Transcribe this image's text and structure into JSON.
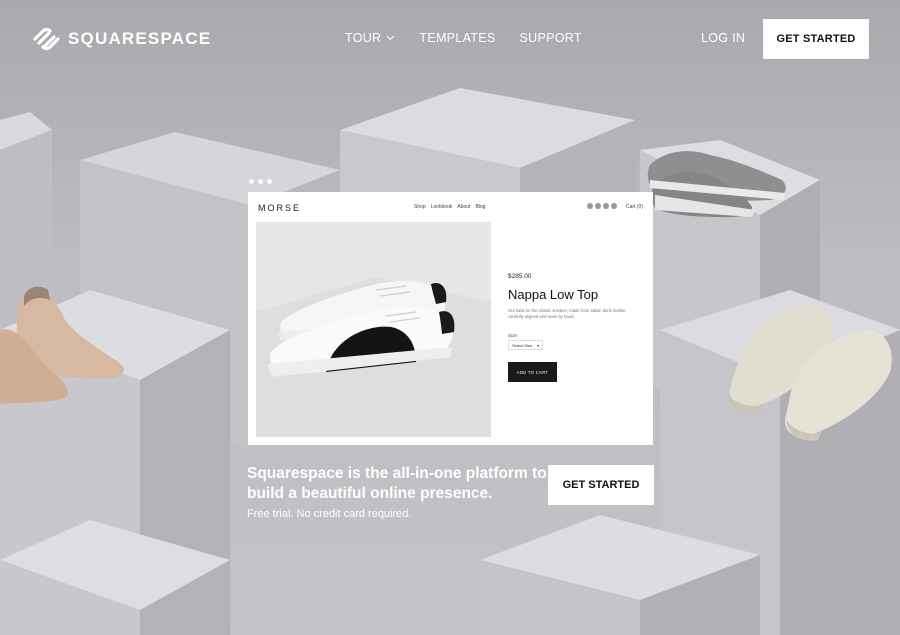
{
  "header": {
    "brand": "SQUARESPACE",
    "nav": [
      {
        "label": "TOUR",
        "has_dropdown": true
      },
      {
        "label": "TEMPLATES",
        "has_dropdown": false
      },
      {
        "label": "SUPPORT",
        "has_dropdown": false
      }
    ],
    "login_label": "LOG IN",
    "cta_label": "GET STARTED"
  },
  "carousel": {
    "dot_count": 3
  },
  "mockup": {
    "site_logo": "MORSE",
    "nav": [
      "Shop",
      "Lookbook",
      "About",
      "Blog"
    ],
    "cart": "Cart (0)",
    "product": {
      "price": "$285.00",
      "title": "Nappa Low Top",
      "description": "Our twist on the classic sneaker, made from Italian lamb leather carefully aligned and sewn by hand.",
      "size_label": "Size:",
      "size_select": "Select Size",
      "add_to_cart": "ADD TO CART"
    }
  },
  "hero": {
    "headline": "Squarespace is the all-in-one platform to build a beautiful online presence.",
    "subline": "Free trial. No credit card required.",
    "cta_label": "GET STARTED"
  },
  "colors": {
    "accent": "#ffffff",
    "button_text": "#111111",
    "dark_button": "#1a1a1a"
  }
}
